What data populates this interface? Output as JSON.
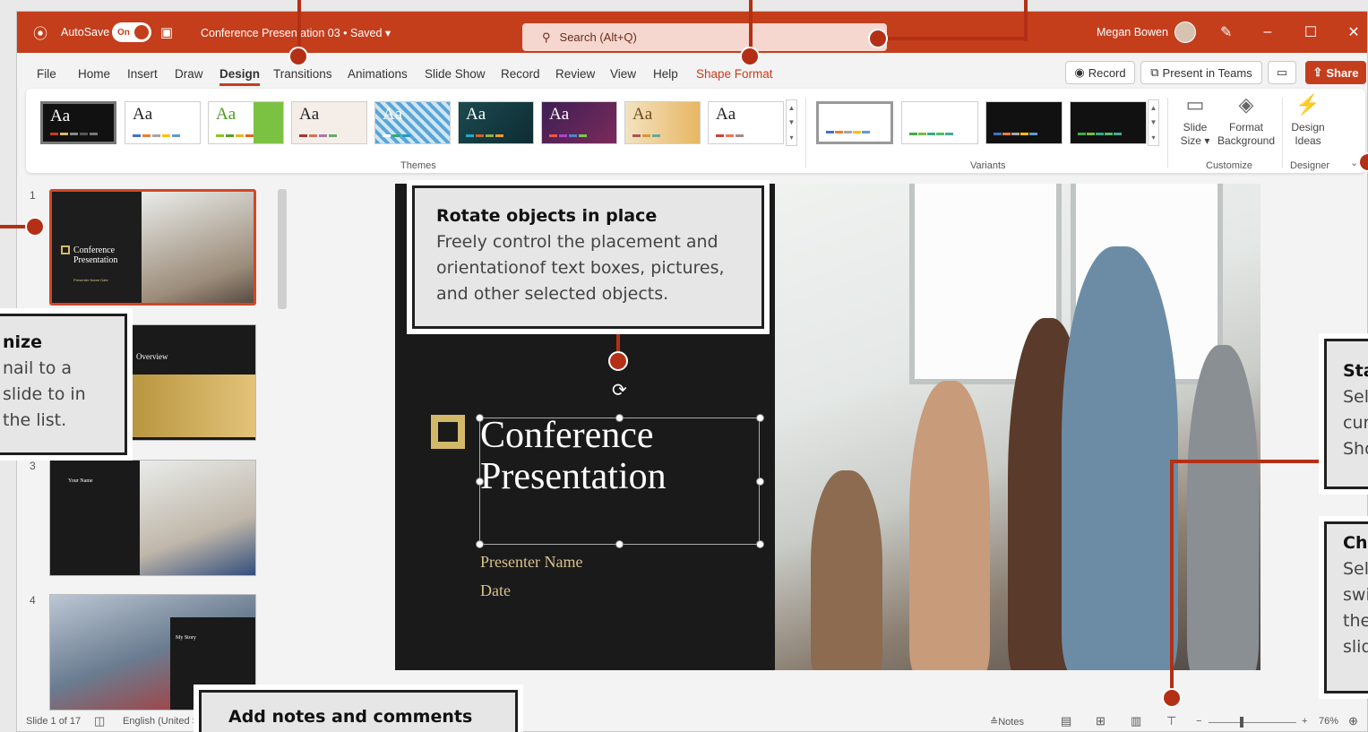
{
  "titlebar": {
    "autosave_label": "AutoSave",
    "autosave_state": "On",
    "doc_title": "Conference Presentation 03 • Saved ▾",
    "search_placeholder": "Search (Alt+Q)",
    "user_name": "Megan Bowen"
  },
  "menu": {
    "tabs": [
      "File",
      "Home",
      "Insert",
      "Draw",
      "Design",
      "Transitions",
      "Animations",
      "Slide Show",
      "Record",
      "Review",
      "View",
      "Help",
      "Shape Format"
    ],
    "active_tab": "Design",
    "record_label": "Record",
    "present_label": "Present in Teams",
    "share_label": "Share"
  },
  "ribbon": {
    "theme_sample": "Aa",
    "themes_group": "Themes",
    "variants_group": "Variants",
    "slide_size_label": "Slide Size ▾",
    "format_bg_label": "Format Background",
    "customize_group": "Customize",
    "design_ideas_label": "Design Ideas",
    "designer_group": "Designer"
  },
  "thumbnails": [
    {
      "num": "1",
      "title": "Conference Presentation",
      "sub": "Presenter Name Date"
    },
    {
      "num": "2",
      "title": "Overview"
    },
    {
      "num": "3",
      "title": "Your Name"
    },
    {
      "num": "4",
      "title": "My Story"
    }
  ],
  "slide": {
    "title_line1": "Conference",
    "title_line2": "Presentation",
    "presenter": "Presenter Name",
    "date": "Date"
  },
  "status": {
    "slide_count": "Slide 1 of 17",
    "language": "English (United St",
    "notes_label": "Notes",
    "zoom": "76%"
  },
  "callouts": {
    "rotate": {
      "title": "Rotate objects in place",
      "body": "Freely control the placement and orientationof text boxes, pictures, and other selected objects."
    },
    "organize": {
      "title": "nize",
      "body": "nail to a slide to in the list."
    },
    "start": {
      "title": "Sta",
      "body": "Sel cur Sho"
    },
    "change": {
      "title": "Cha",
      "body": "Sel swi the slid"
    },
    "notes": {
      "title": "Add notes and comments"
    }
  },
  "colors": {
    "accent": "#c43e1c",
    "callout_line": "#b33016",
    "gold": "#d4b86a"
  }
}
